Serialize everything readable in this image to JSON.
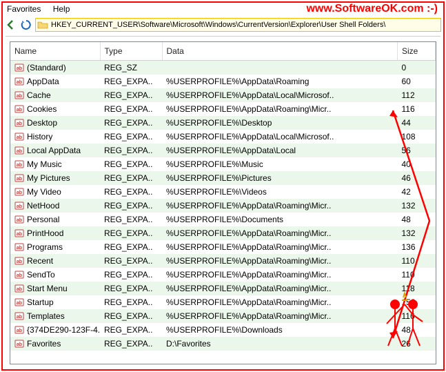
{
  "watermark": "www.SoftwareOK.com :-)",
  "menu": {
    "favorites": "Favorites",
    "help": "Help"
  },
  "address": "HKEY_CURRENT_USER\\Software\\Microsoft\\Windows\\CurrentVersion\\Explorer\\User Shell Folders\\",
  "columns": {
    "name": "Name",
    "type": "Type",
    "data": "Data",
    "size": "Size"
  },
  "rows": [
    {
      "name": "(Standard)",
      "type": "REG_SZ",
      "data": "",
      "size": "0"
    },
    {
      "name": "AppData",
      "type": "REG_EXPA..",
      "data": "%USERPROFILE%\\AppData\\Roaming",
      "size": "60"
    },
    {
      "name": "Cache",
      "type": "REG_EXPA..",
      "data": "%USERPROFILE%\\AppData\\Local\\Microsof..",
      "size": "112"
    },
    {
      "name": "Cookies",
      "type": "REG_EXPA..",
      "data": "%USERPROFILE%\\AppData\\Roaming\\Micr..",
      "size": "116"
    },
    {
      "name": "Desktop",
      "type": "REG_EXPA..",
      "data": "%USERPROFILE%\\Desktop",
      "size": "44"
    },
    {
      "name": "History",
      "type": "REG_EXPA..",
      "data": "%USERPROFILE%\\AppData\\Local\\Microsof..",
      "size": "108"
    },
    {
      "name": "Local AppData",
      "type": "REG_EXPA..",
      "data": "%USERPROFILE%\\AppData\\Local",
      "size": "56"
    },
    {
      "name": "My Music",
      "type": "REG_EXPA..",
      "data": "%USERPROFILE%\\Music",
      "size": "40"
    },
    {
      "name": "My Pictures",
      "type": "REG_EXPA..",
      "data": "%USERPROFILE%\\Pictures",
      "size": "46"
    },
    {
      "name": "My Video",
      "type": "REG_EXPA..",
      "data": "%USERPROFILE%\\Videos",
      "size": "42"
    },
    {
      "name": "NetHood",
      "type": "REG_EXPA..",
      "data": "%USERPROFILE%\\AppData\\Roaming\\Micr..",
      "size": "132"
    },
    {
      "name": "Personal",
      "type": "REG_EXPA..",
      "data": "%USERPROFILE%\\Documents",
      "size": "48"
    },
    {
      "name": "PrintHood",
      "type": "REG_EXPA..",
      "data": "%USERPROFILE%\\AppData\\Roaming\\Micr..",
      "size": "132"
    },
    {
      "name": "Programs",
      "type": "REG_EXPA..",
      "data": "%USERPROFILE%\\AppData\\Roaming\\Micr..",
      "size": "136"
    },
    {
      "name": "Recent",
      "type": "REG_EXPA..",
      "data": "%USERPROFILE%\\AppData\\Roaming\\Micr..",
      "size": "110"
    },
    {
      "name": "SendTo",
      "type": "REG_EXPA..",
      "data": "%USERPROFILE%\\AppData\\Roaming\\Micr..",
      "size": "110"
    },
    {
      "name": "Start Menu",
      "type": "REG_EXPA..",
      "data": "%USERPROFILE%\\AppData\\Roaming\\Micr..",
      "size": "118"
    },
    {
      "name": "Startup",
      "type": "REG_EXPA..",
      "data": "%USERPROFILE%\\AppData\\Roaming\\Micr..",
      "size": "152"
    },
    {
      "name": "Templates",
      "type": "REG_EXPA..",
      "data": "%USERPROFILE%\\AppData\\Roaming\\Micr..",
      "size": "116"
    },
    {
      "name": "{374DE290-123F-4..",
      "type": "REG_EXPA..",
      "data": "%USERPROFILE%\\Downloads",
      "size": "48"
    },
    {
      "name": "Favorites",
      "type": "REG_EXPA..",
      "data": "D:\\Favorites",
      "size": "26"
    }
  ]
}
